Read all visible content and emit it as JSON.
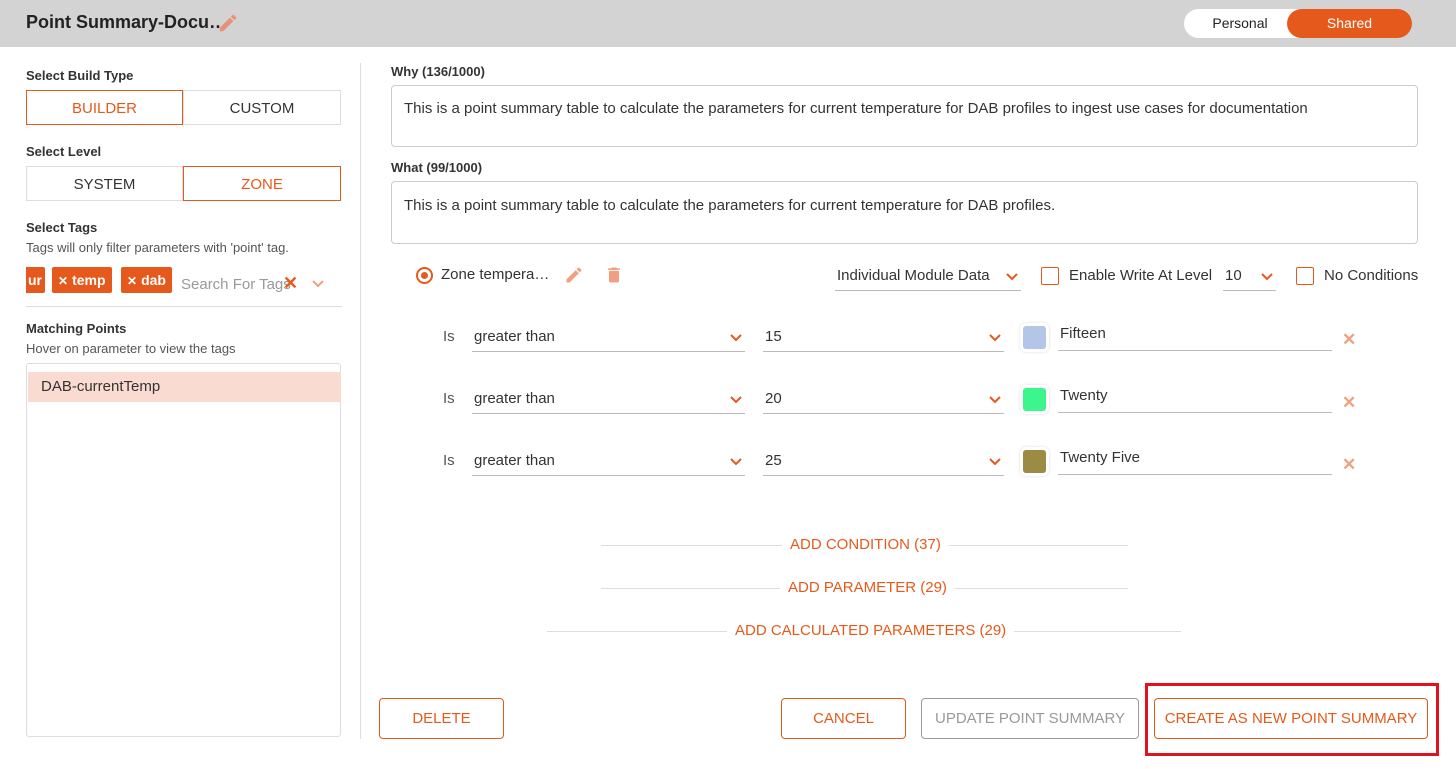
{
  "header": {
    "title": "Point Summary-Docu…",
    "toggle": {
      "personal": "Personal",
      "shared": "Shared",
      "selected": "Shared"
    }
  },
  "sidebar": {
    "build_type": {
      "label": "Select Build Type",
      "options": [
        "BUILDER",
        "CUSTOM"
      ],
      "selected": "BUILDER"
    },
    "level": {
      "label": "Select Level",
      "options": [
        "SYSTEM",
        "ZONE"
      ],
      "selected": "ZONE"
    },
    "tags": {
      "label": "Select Tags",
      "hint": "Tags will only filter parameters with 'point' tag.",
      "chips": [
        "ur",
        "temp",
        "dab"
      ],
      "search_placeholder": "Search For Tags",
      "clear_glyph": "✕"
    },
    "matching": {
      "label": "Matching Points",
      "hint": "Hover on parameter to view the tags",
      "items": [
        "DAB-currentTemp"
      ]
    }
  },
  "main": {
    "why": {
      "label": "Why (136/1000)",
      "value": "This is a point summary table to calculate the parameters for current temperature for DAB profiles to ingest use cases for documentation"
    },
    "what": {
      "label": "What (99/1000)",
      "value": "This is a point summary table to calculate the parameters for current temperature for DAB profiles."
    },
    "parameter": {
      "name": "Zone tempera…",
      "data_mode": "Individual Module Data",
      "enable_write_label": "Enable Write At Level",
      "write_level": "10",
      "no_conditions_label": "No Conditions",
      "enable_write_checked": false,
      "no_conditions_checked": false
    },
    "conditions": [
      {
        "is_label": "Is",
        "operator": "greater than",
        "value": "15",
        "color": "#b4c6e7",
        "label": "Fifteen",
        "remove": "✕"
      },
      {
        "is_label": "Is",
        "operator": "greater than",
        "value": "20",
        "color": "#3cf58c",
        "label": "Twenty",
        "remove": "✕"
      },
      {
        "is_label": "Is",
        "operator": "greater than",
        "value": "25",
        "color": "#9c8b45",
        "label": "Twenty Five",
        "remove": "✕"
      }
    ],
    "add_condition": "ADD CONDITION (37)",
    "add_parameter": "ADD PARAMETER (29)",
    "add_calculated": "ADD CALCULATED PARAMETERS (29)"
  },
  "footer": {
    "delete": "DELETE",
    "cancel": "CANCEL",
    "update": "UPDATE POINT SUMMARY",
    "create": "CREATE AS NEW POINT SUMMARY"
  },
  "colors": {
    "accent": "#e55a1c",
    "highlight": "#e3101e",
    "selected_row": "#fadbd1"
  }
}
